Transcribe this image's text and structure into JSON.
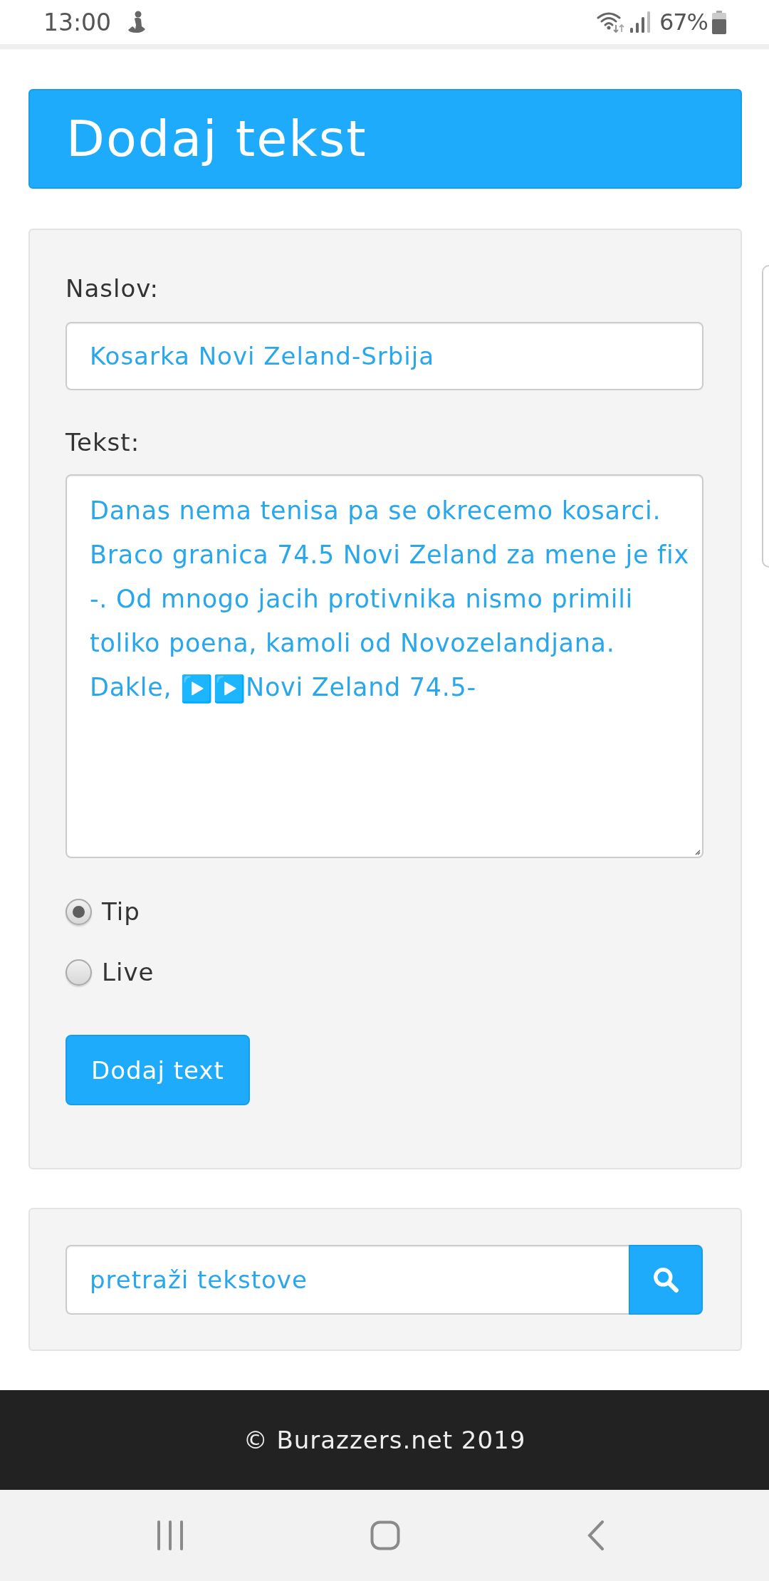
{
  "status_bar": {
    "time": "13:00",
    "battery": "67%"
  },
  "header": {
    "title": "Dodaj tekst"
  },
  "form": {
    "title_field": {
      "label": "Naslov:",
      "value": "Kosarka Novi Zeland-Srbija"
    },
    "text_field": {
      "label": "Tekst:",
      "value": [
        {
          "kind": "text",
          "text": "Danas nema tenisa pa se okrecemo kosarci. Braco granica 74.5 Novi Zeland za mene je fix -. Od mnogo jacih protivnika nismo primili toliko poena, kamoli od Novozelandjana. Dakle, "
        },
        {
          "kind": "emoji",
          "text": "▶️"
        },
        {
          "kind": "emoji",
          "text": "▶️"
        },
        {
          "kind": "text",
          "text": "Novi Zeland 74.5-"
        }
      ]
    },
    "type_options": [
      {
        "label": "Tip",
        "selected": true
      },
      {
        "label": "Live",
        "selected": false
      }
    ],
    "submit_button": "Dodaj text"
  },
  "search": {
    "placeholder": "pretraži tekstove"
  },
  "footer": {
    "text": "© Burazzers.net 2019"
  }
}
